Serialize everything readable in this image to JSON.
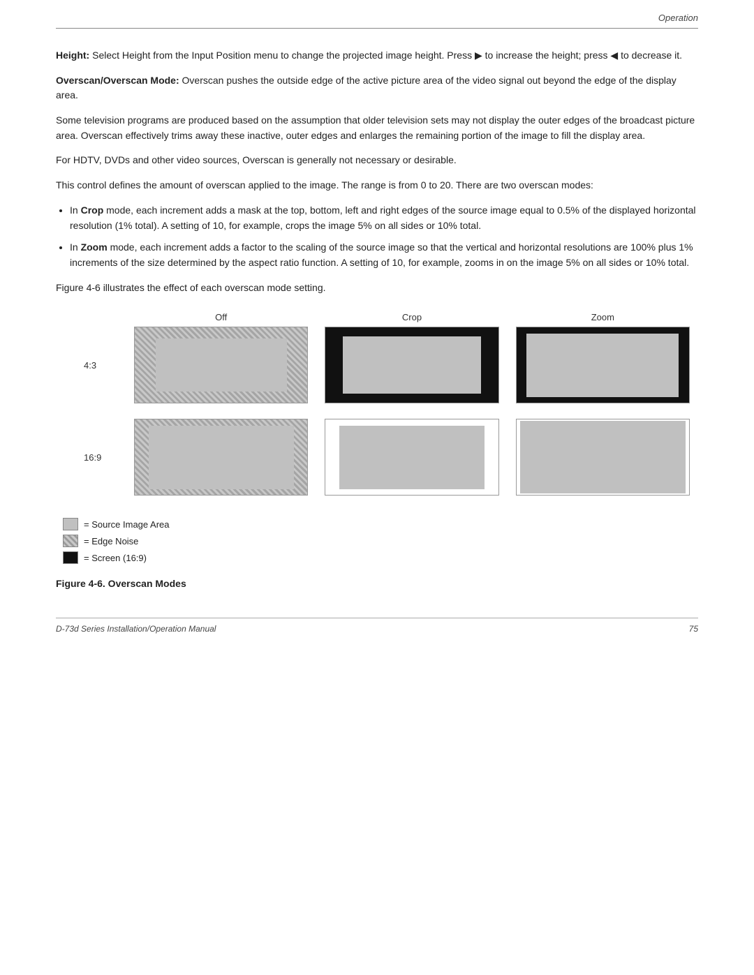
{
  "header": {
    "section_label": "Operation"
  },
  "content": {
    "height_para": {
      "bold_part": "Height:",
      "text": " Select Height from the Input Position menu to change the projected image height. Press ▶ to increase the height; press ◀ to decrease it."
    },
    "overscan_mode_para": {
      "bold_part": "Overscan/Overscan Mode:",
      "text": " Overscan pushes the outside edge of the active picture area of the video signal out beyond the edge of the display area."
    },
    "para1": "Some television programs are produced based on the assumption that older television sets may not display the outer edges of the broadcast picture area. Overscan effectively trims away these inactive, outer edges and enlarges the remaining portion of the image to fill the display area.",
    "para2": "For HDTV, DVDs and other video sources, Overscan is generally not necessary or desirable.",
    "para3": "This control defines the amount of overscan applied to the image. The range is from 0 to 20. There are two overscan modes:",
    "bullets": [
      {
        "bold_part": "Crop",
        "text": " mode, each increment adds a mask at the top, bottom, left and right edges of the source image equal to 0.5% of the displayed horizontal resolution (1% total). A setting of 10, for example, crops the image 5% on all sides or 10% total."
      },
      {
        "bold_part": "Zoom",
        "text": " mode, each increment adds a factor to the scaling of the source image so that the vertical and horizontal resolutions are 100% plus 1% increments of the size determined by the aspect ratio function. A setting of 10, for example, zooms in on the image 5% on all sides or 10% total."
      }
    ],
    "figure_intro": "Figure 4-6 illustrates the effect of each overscan mode setting.",
    "col_labels": [
      "Off",
      "Crop",
      "Zoom"
    ],
    "row_labels": [
      "4:3",
      "16:9"
    ],
    "legend": {
      "source_label": "= Source Image Area",
      "noise_label": "= Edge Noise",
      "screen_label": "= Screen (16:9)"
    },
    "figure_caption": "Figure 4-6. Overscan Modes"
  },
  "footer": {
    "left": "D-73d Series Installation/Operation Manual",
    "right": "75"
  }
}
